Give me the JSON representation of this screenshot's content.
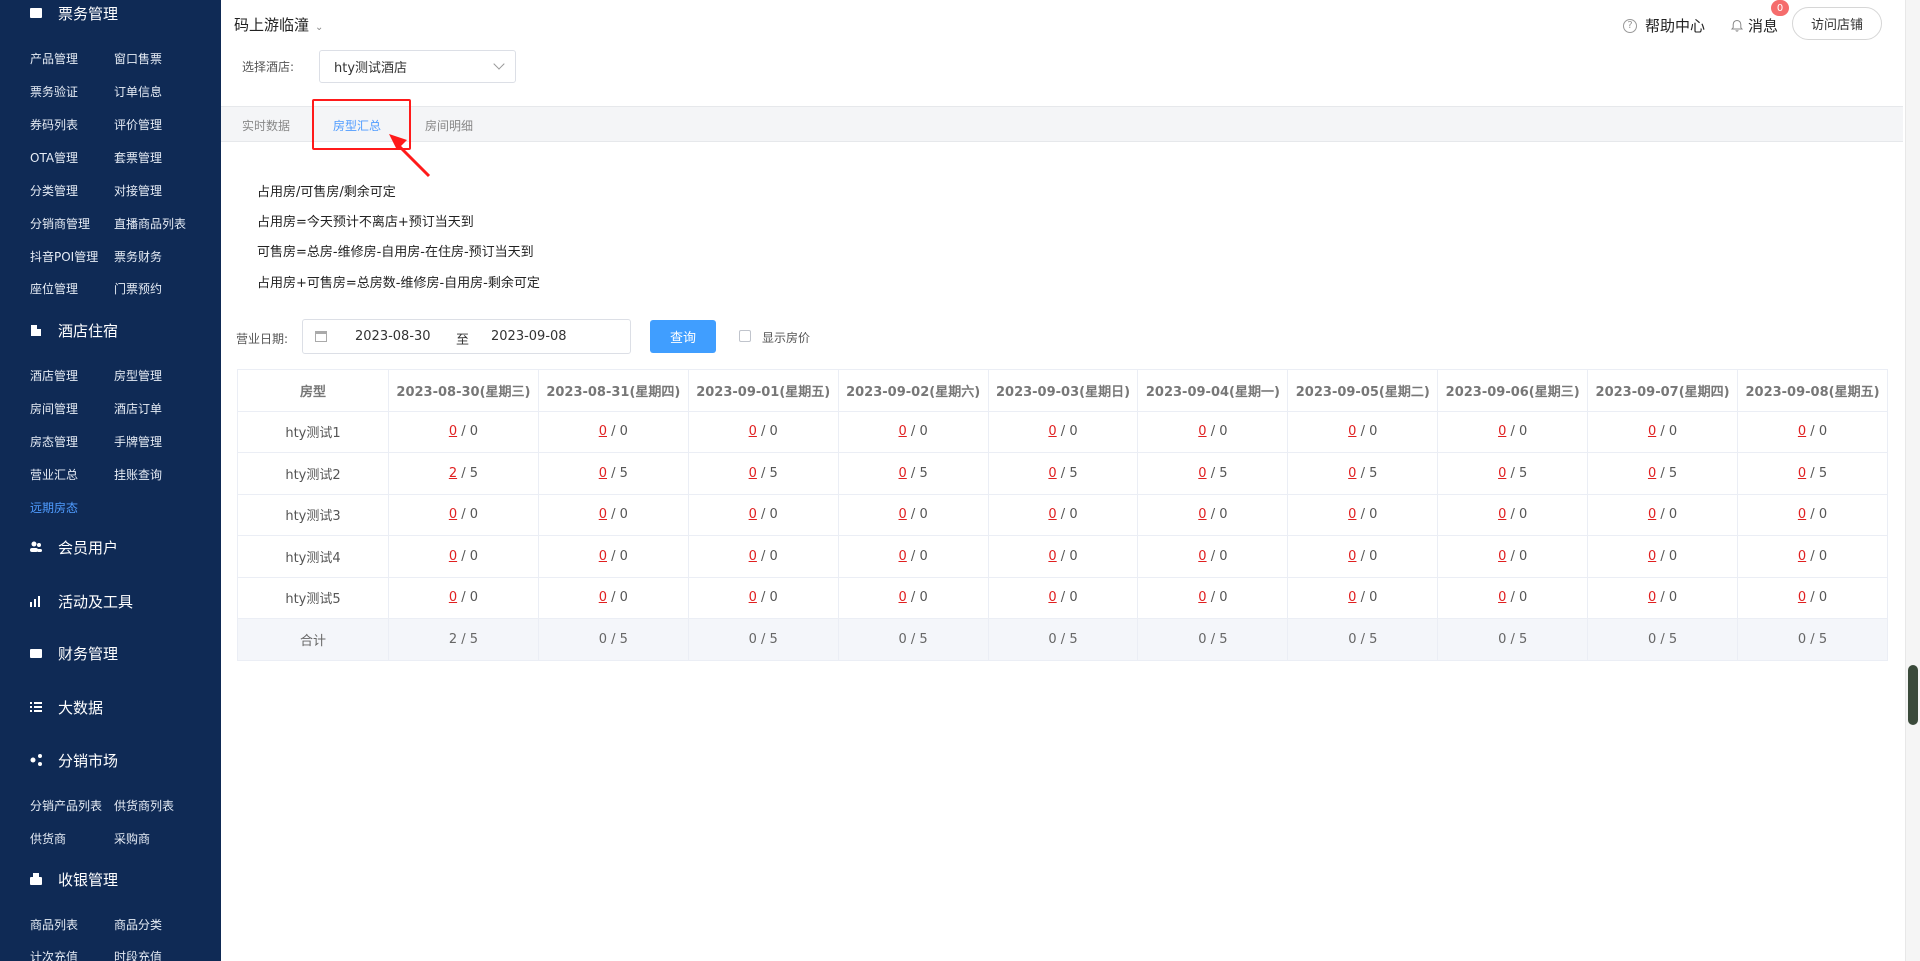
{
  "sidebar": {
    "sections": [
      {
        "label": "票务管理",
        "icon": "ticket-icon"
      },
      {
        "label": "酒店住宿",
        "icon": "building-icon"
      },
      {
        "label": "会员用户",
        "icon": "users-icon"
      },
      {
        "label": "活动及工具",
        "icon": "chart-icon"
      },
      {
        "label": "财务管理",
        "icon": "wallet-icon"
      },
      {
        "label": "大数据",
        "icon": "list-icon"
      },
      {
        "label": "分销市场",
        "icon": "share-icon"
      },
      {
        "label": "收银管理",
        "icon": "cashier-icon"
      }
    ],
    "ticket_items": [
      "产品管理",
      "窗口售票",
      "票务验证",
      "订单信息",
      "券码列表",
      "评价管理",
      "OTA管理",
      "套票管理",
      "分类管理",
      "对接管理",
      "分销商管理",
      "直播商品列表",
      "抖音POI管理",
      "票务财务",
      "座位管理",
      "门票预约"
    ],
    "hotel_items": [
      "酒店管理",
      "房型管理",
      "房间管理",
      "酒店订单",
      "房态管理",
      "手牌管理",
      "营业汇总",
      "挂账查询",
      "远期房态"
    ],
    "dist_items": [
      "分销产品列表",
      "供货商列表",
      "供货商",
      "采购商"
    ],
    "cashier_items": [
      "商品列表",
      "商品分类",
      "计次充值",
      "时段充值"
    ]
  },
  "header": {
    "hotel_name": "码上游临潼",
    "help": "帮助中心",
    "messages": "消息",
    "badge": "0",
    "visit_store": "访问店铺"
  },
  "filter": {
    "hotel_label": "选择酒店:",
    "hotel_value": "hty测试酒店"
  },
  "tabs": [
    "实时数据",
    "房型汇总",
    "房间明细"
  ],
  "info_lines": [
    "占用房/可售房/剩余可定",
    "占用房=今天预计不离店+预订当天到",
    "可售房=总房-维修房-自用房-在住房-预订当天到",
    "占用房+可售房=总房数-维修房-自用房-剩余可定"
  ],
  "date_filter": {
    "label": "营业日期:",
    "start": "2023-08-30",
    "separator": "至",
    "end": "2023-09-08",
    "query_button": "查询",
    "show_price": "显示房价"
  },
  "table": {
    "type_header": "房型",
    "dates": [
      "2023-08-30(星期三)",
      "2023-08-31(星期四)",
      "2023-09-01(星期五)",
      "2023-09-02(星期六)",
      "2023-09-03(星期日)",
      "2023-09-04(星期一)",
      "2023-09-05(星期二)",
      "2023-09-06(星期三)",
      "2023-09-07(星期四)",
      "2023-09-08(星期五)"
    ],
    "rows": [
      {
        "type": "hty测试1",
        "cells": [
          [
            "0",
            "0"
          ],
          [
            "0",
            "0"
          ],
          [
            "0",
            "0"
          ],
          [
            "0",
            "0"
          ],
          [
            "0",
            "0"
          ],
          [
            "0",
            "0"
          ],
          [
            "0",
            "0"
          ],
          [
            "0",
            "0"
          ],
          [
            "0",
            "0"
          ],
          [
            "0",
            "0"
          ]
        ]
      },
      {
        "type": "hty测试2",
        "cells": [
          [
            "2",
            "5"
          ],
          [
            "0",
            "5"
          ],
          [
            "0",
            "5"
          ],
          [
            "0",
            "5"
          ],
          [
            "0",
            "5"
          ],
          [
            "0",
            "5"
          ],
          [
            "0",
            "5"
          ],
          [
            "0",
            "5"
          ],
          [
            "0",
            "5"
          ],
          [
            "0",
            "5"
          ]
        ]
      },
      {
        "type": "hty测试3",
        "cells": [
          [
            "0",
            "0"
          ],
          [
            "0",
            "0"
          ],
          [
            "0",
            "0"
          ],
          [
            "0",
            "0"
          ],
          [
            "0",
            "0"
          ],
          [
            "0",
            "0"
          ],
          [
            "0",
            "0"
          ],
          [
            "0",
            "0"
          ],
          [
            "0",
            "0"
          ],
          [
            "0",
            "0"
          ]
        ]
      },
      {
        "type": "hty测试4",
        "cells": [
          [
            "0",
            "0"
          ],
          [
            "0",
            "0"
          ],
          [
            "0",
            "0"
          ],
          [
            "0",
            "0"
          ],
          [
            "0",
            "0"
          ],
          [
            "0",
            "0"
          ],
          [
            "0",
            "0"
          ],
          [
            "0",
            "0"
          ],
          [
            "0",
            "0"
          ],
          [
            "0",
            "0"
          ]
        ]
      },
      {
        "type": "hty测试5",
        "cells": [
          [
            "0",
            "0"
          ],
          [
            "0",
            "0"
          ],
          [
            "0",
            "0"
          ],
          [
            "0",
            "0"
          ],
          [
            "0",
            "0"
          ],
          [
            "0",
            "0"
          ],
          [
            "0",
            "0"
          ],
          [
            "0",
            "0"
          ],
          [
            "0",
            "0"
          ],
          [
            "0",
            "0"
          ]
        ]
      }
    ],
    "total_label": "合计",
    "totals": [
      "2 / 5",
      "0 / 5",
      "0 / 5",
      "0 / 5",
      "0 / 5",
      "0 / 5",
      "0 / 5",
      "0 / 5",
      "0 / 5",
      "0 / 5"
    ]
  },
  "colors": {
    "sidebar_bg": "#0f2a55",
    "accent": "#409eff",
    "occupied": "#e02020",
    "annotation": "#ff1a1a"
  }
}
